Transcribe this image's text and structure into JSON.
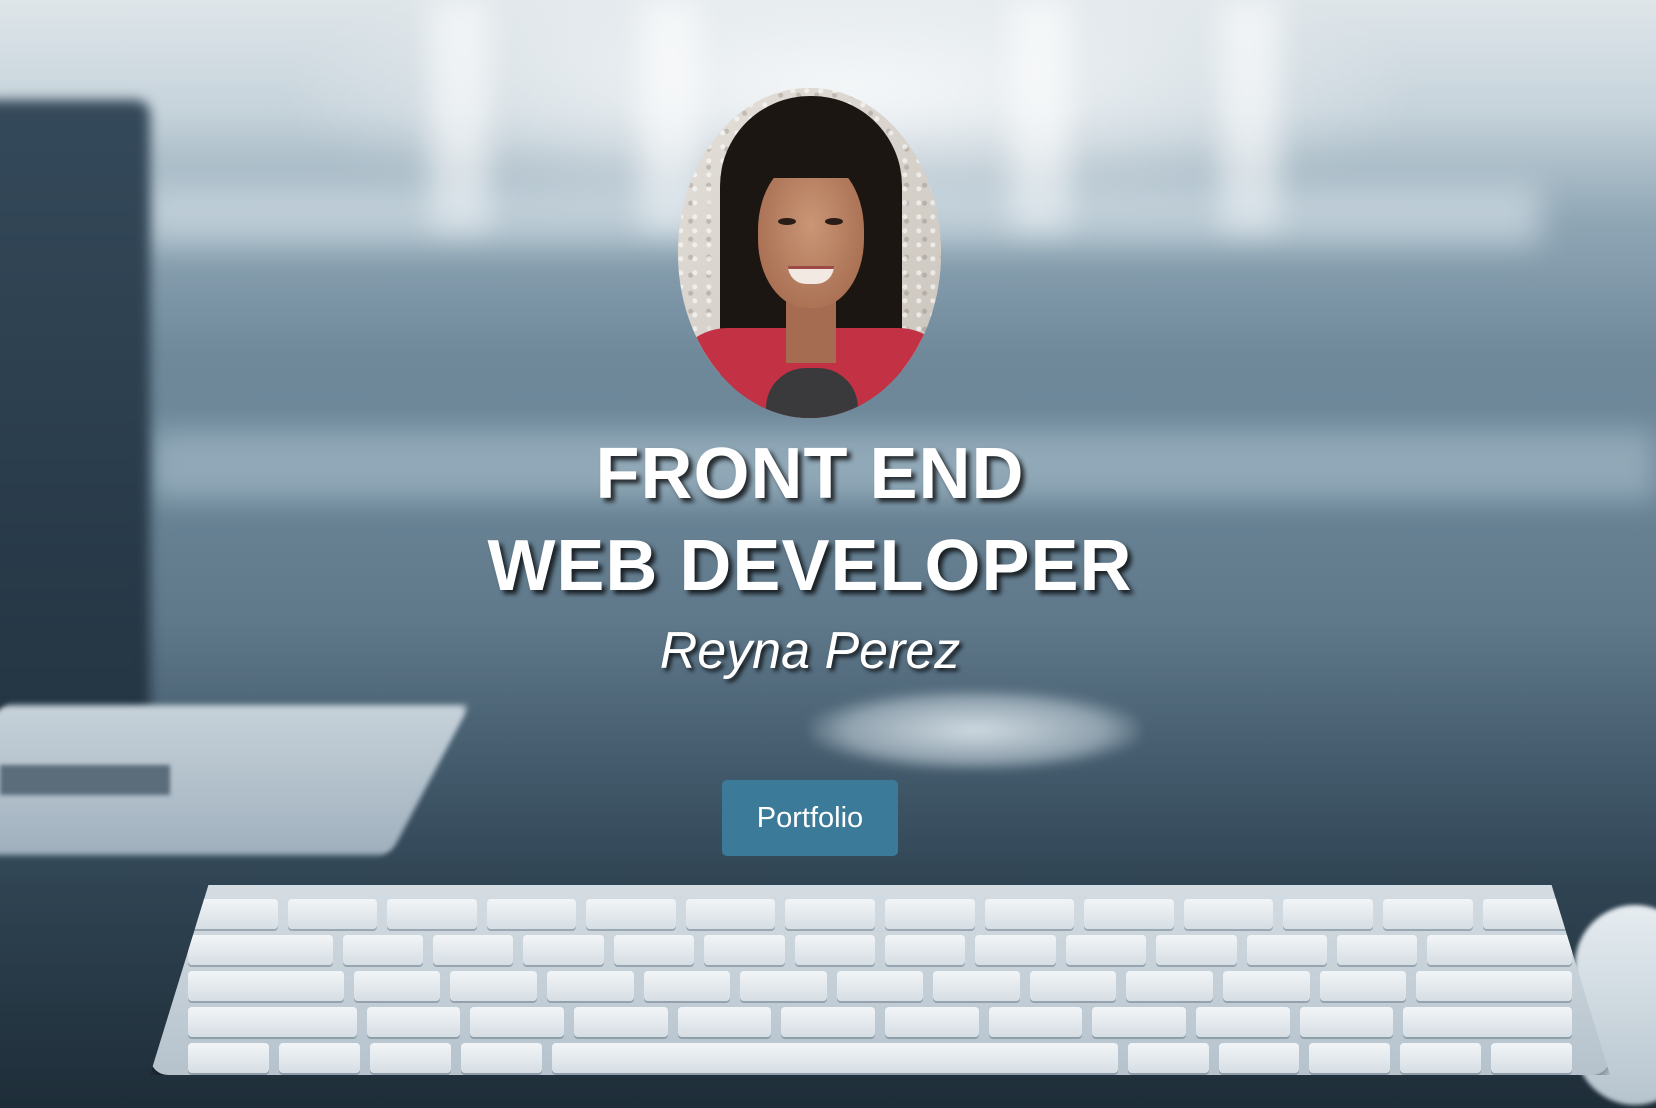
{
  "hero": {
    "headline_line1": "FRONT END",
    "headline_line2": "WEB DEVELOPER",
    "name": "Reyna Perez",
    "portfolio_button_label": "Portfolio"
  },
  "colors": {
    "button_background": "#3c7a99",
    "text": "#ffffff"
  }
}
